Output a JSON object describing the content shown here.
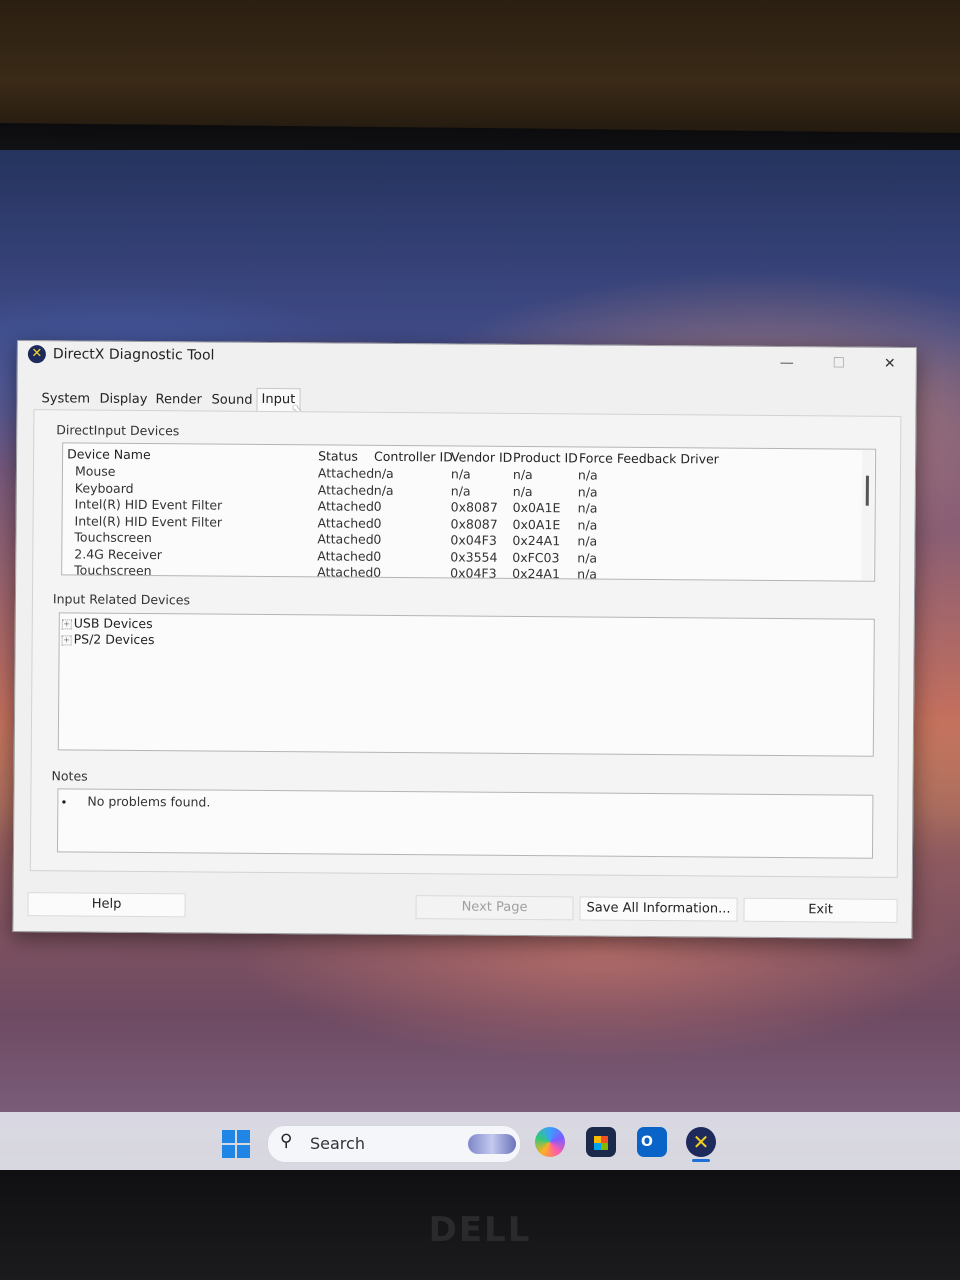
{
  "window": {
    "title": "DirectX Diagnostic Tool",
    "controls": {
      "minimize": "—",
      "maximize": "☐",
      "close": "✕"
    }
  },
  "tabs": [
    {
      "label": "System"
    },
    {
      "label": "Display"
    },
    {
      "label": "Render"
    },
    {
      "label": "Sound"
    },
    {
      "label": "Input",
      "active": true
    }
  ],
  "directinput": {
    "section_label": "DirectInput Devices",
    "columns": [
      "Device Name",
      "Status",
      "Controller ID",
      "Vendor ID",
      "Product ID",
      "Force Feedback Driver"
    ],
    "rows": [
      [
        "Mouse",
        "Attached",
        "n/a",
        "n/a",
        "n/a",
        "n/a"
      ],
      [
        "Keyboard",
        "Attached",
        "n/a",
        "n/a",
        "n/a",
        "n/a"
      ],
      [
        "Intel(R) HID Event Filter",
        "Attached",
        "0",
        "0x8087",
        "0x0A1E",
        "n/a"
      ],
      [
        "Intel(R) HID Event Filter",
        "Attached",
        "0",
        "0x8087",
        "0x0A1E",
        "n/a"
      ],
      [
        "Touchscreen",
        "Attached",
        "0",
        "0x04F3",
        "0x24A1",
        "n/a"
      ],
      [
        "2.4G Receiver",
        "Attached",
        "0",
        "0x3554",
        "0xFC03",
        "n/a"
      ],
      [
        "Touchscreen",
        "Attached",
        "0",
        "0x04F3",
        "0x24A1",
        "n/a"
      ]
    ]
  },
  "input_related": {
    "section_label": "Input Related Devices",
    "items": [
      "USB Devices",
      "PS/2 Devices"
    ]
  },
  "notes": {
    "section_label": "Notes",
    "bullet": "•",
    "text": "No problems found."
  },
  "buttons": {
    "help": "Help",
    "next_page": "Next Page",
    "save_all": "Save All Information...",
    "exit": "Exit"
  },
  "taskbar": {
    "search_label": "Search"
  },
  "bezel": {
    "brand": "DELL"
  },
  "colors": {
    "accent": "#1f86e6",
    "window_bg": "#f0f0f0",
    "dxdiag_icon": "#1f2a5c"
  },
  "icons": [
    "windows-start-icon",
    "search-icon",
    "copilot-icon",
    "store-icon",
    "outlook-icon",
    "dxdiag-icon"
  ]
}
